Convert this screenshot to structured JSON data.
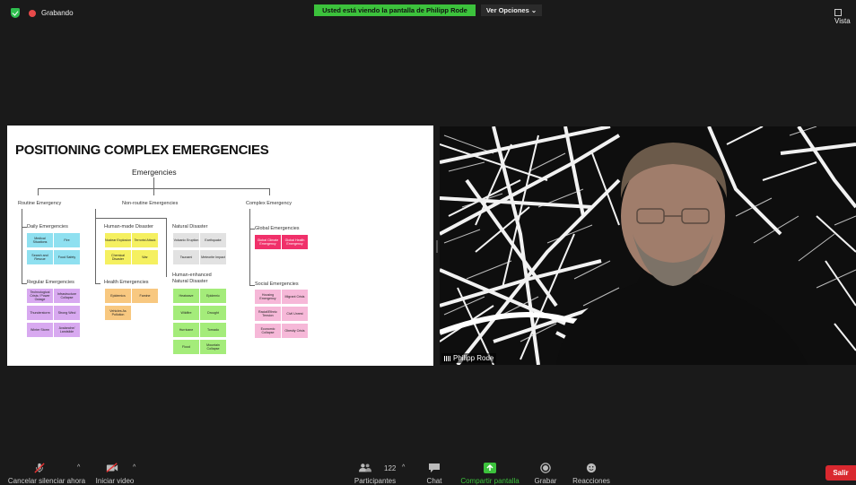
{
  "topbar": {
    "recording_label": "Grabando",
    "share_banner": "Usted está viendo la pantalla de Philipp Rode",
    "view_options": "Ver Opciones",
    "view_options_caret": "⌄",
    "view_label": "Vista"
  },
  "slide": {
    "title": "POSITIONING COMPLEX EMERGENCIES",
    "root": "Emergencies",
    "routine": {
      "label": "Routine Emergency",
      "daily_label": "Daily Emergencies",
      "daily": [
        "Medical Situations",
        "Fire",
        "Search and Rescue",
        "Food Safety"
      ],
      "regular_label": "Regular Emergencies",
      "regular": [
        "Technological Crisis / Power Outage",
        "Infrastructure Collapse",
        "Thunderstorm",
        "Strong Wind",
        "Winter Storm",
        "Avalanche/ Landslide"
      ]
    },
    "nonroutine": {
      "label": "Non-routine Emergencies",
      "human_label": "Human-made Disaster",
      "human": [
        "Nuclear Explosion",
        "Terrorist Attack",
        "Chemical Disaster",
        "War"
      ],
      "health_label": "Health Emergencies",
      "health": [
        "Epidemics",
        "Famine",
        "Vehicles As Pollution"
      ],
      "natural_label": "Natural Disaster",
      "natural": [
        "Volcanic Eruption",
        "Earthquake",
        "Tsunami",
        "Meteorite Impact"
      ],
      "enhanced_label": "Human-enhanced Natural Disaster",
      "enhanced": [
        "Heatwave",
        "Epidemic",
        "Wildfire",
        "Drought",
        "Hurricane",
        "Tornado",
        "Flood",
        "Mountain Collapse"
      ]
    },
    "complex": {
      "label": "Complex Emergency",
      "global_label": "Global Emergencies",
      "global": [
        "Global Climate Emergency",
        "Global Health Emergency"
      ],
      "social_label": "Social Emergencies",
      "social": [
        "Housing Emergency",
        "Migrant Crisis",
        "Racial/Ethnic Tension",
        "Civil Unrest",
        "Economic Collapse",
        "Obesity Crisis"
      ]
    }
  },
  "video": {
    "participant_name": "Philipp Rode"
  },
  "toolbar": {
    "mute_label": "Cancelar silenciar ahora",
    "video_label": "Iniciar video",
    "participants_label": "Participantes",
    "participants_count": "122",
    "chat_label": "Chat",
    "share_label": "Compartir pantalla",
    "record_label": "Grabar",
    "reactions_label": "Reacciones",
    "leave_label": "Salir",
    "caret": "^"
  },
  "colors": {
    "share_green": "#3cc23c",
    "leave_red": "#d9282f",
    "recording_red": "#e84a4a"
  }
}
